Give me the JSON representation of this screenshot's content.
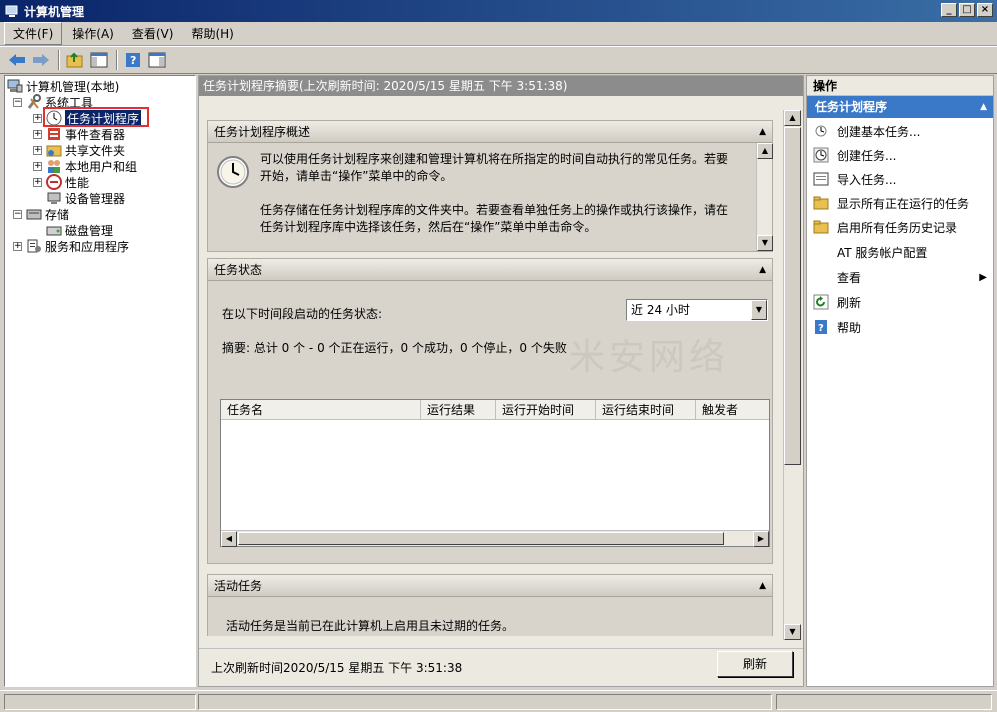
{
  "window": {
    "title": "计算机管理",
    "buttons": [
      "_",
      "□",
      "×"
    ]
  },
  "menubar": {
    "items": [
      "文件(F)",
      "操作(A)",
      "查看(V)",
      "帮助(H)"
    ]
  },
  "tree": {
    "items": [
      {
        "label": "计算机管理(本地)",
        "icon": "computer-management-icon"
      },
      {
        "label": "系统工具",
        "icon": "tools-icon"
      },
      {
        "label": "任务计划程序",
        "icon": "clock-icon",
        "selected": true
      },
      {
        "label": "事件查看器",
        "icon": "event-viewer-icon"
      },
      {
        "label": "共享文件夹",
        "icon": "shared-folder-icon"
      },
      {
        "label": "本地用户和组",
        "icon": "users-icon"
      },
      {
        "label": "性能",
        "icon": "performance-icon"
      },
      {
        "label": "设备管理器",
        "icon": "device-manager-icon"
      },
      {
        "label": "存储",
        "icon": "storage-icon"
      },
      {
        "label": "磁盘管理",
        "icon": "disk-icon"
      },
      {
        "label": "服务和应用程序",
        "icon": "services-icon"
      }
    ]
  },
  "center": {
    "header": "任务计划程序摘要(上次刷新时间: 2020/5/15 星期五 下午 3:51:38)",
    "overview": {
      "title": "任务计划程序概述",
      "line1": "可以使用任务计划程序来创建和管理计算机将在所指定的时间自动执行的常见任务。若要",
      "line2": "开始，请单击“操作”菜单中的命令。",
      "line3": "任务存储在任务计划程序库的文件夹中。若要查看单独任务上的操作或执行该操作，请在",
      "line4": "任务计划程序库中选择该任务，然后在“操作”菜单中单击命令。"
    },
    "status": {
      "title": "任务状态",
      "period_label": "在以下时间段启动的任务状态:",
      "period_value": "近 24 小时",
      "summary": "摘要: 总计 0 个 - 0 个正在运行，0 个成功，0 个停止，0 个失败",
      "columns": [
        "任务名",
        "运行结果",
        "运行开始时间",
        "运行结束时间",
        "触发者"
      ]
    },
    "active": {
      "title": "活动任务",
      "text": "活动任务是当前已在此计算机上启用且未过期的任务。"
    },
    "footer": {
      "last_refresh": "上次刷新时间2020/5/15 星期五 下午 3:51:38",
      "refresh_button": "刷新"
    },
    "watermark": "米安网络"
  },
  "actions": {
    "header": "操作",
    "group": "任务计划程序",
    "items": [
      {
        "label": "创建基本任务...",
        "icon": "create-basic-task-icon"
      },
      {
        "label": "创建任务...",
        "icon": "create-task-icon"
      },
      {
        "label": "导入任务...",
        "icon": "import-task-icon"
      },
      {
        "label": "显示所有正在运行的任务",
        "icon": "folder-icon"
      },
      {
        "label": "启用所有任务历史记录",
        "icon": "folder-icon"
      },
      {
        "label": "AT 服务帐户配置",
        "icon": ""
      },
      {
        "label": "查看",
        "icon": "",
        "submenu": true
      },
      {
        "label": "刷新",
        "icon": "refresh-icon"
      },
      {
        "label": "帮助",
        "icon": "help-icon"
      }
    ]
  }
}
